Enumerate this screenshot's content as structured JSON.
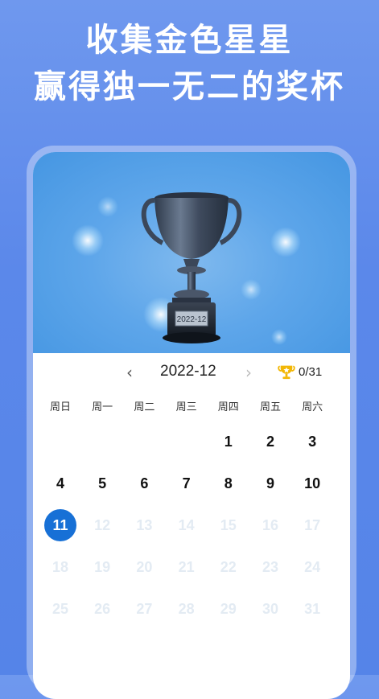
{
  "headline": {
    "line1": "收集金色星星",
    "line2": "赢得独一无二的奖杯"
  },
  "trophy": {
    "plaque_label": "2022-12",
    "color": "#3e4a5c"
  },
  "calendar": {
    "month_label": "2022-12",
    "prev_icon": "chevron-left-icon",
    "next_icon": "chevron-right-icon",
    "trophy_count": "0/31",
    "weekdays": [
      "周日",
      "周一",
      "周二",
      "周三",
      "周四",
      "周五",
      "周六"
    ],
    "first_weekday_index": 4,
    "days": [
      {
        "n": "1",
        "state": "active"
      },
      {
        "n": "2",
        "state": "active"
      },
      {
        "n": "3",
        "state": "active"
      },
      {
        "n": "4",
        "state": "active"
      },
      {
        "n": "5",
        "state": "active"
      },
      {
        "n": "6",
        "state": "active"
      },
      {
        "n": "7",
        "state": "active"
      },
      {
        "n": "8",
        "state": "active"
      },
      {
        "n": "9",
        "state": "active"
      },
      {
        "n": "10",
        "state": "active"
      },
      {
        "n": "11",
        "state": "today"
      },
      {
        "n": "12",
        "state": "future"
      },
      {
        "n": "13",
        "state": "future"
      },
      {
        "n": "14",
        "state": "future"
      },
      {
        "n": "15",
        "state": "future"
      },
      {
        "n": "16",
        "state": "future"
      },
      {
        "n": "17",
        "state": "future"
      },
      {
        "n": "18",
        "state": "future"
      },
      {
        "n": "19",
        "state": "future"
      },
      {
        "n": "20",
        "state": "future"
      },
      {
        "n": "21",
        "state": "future"
      },
      {
        "n": "22",
        "state": "future"
      },
      {
        "n": "23",
        "state": "future"
      },
      {
        "n": "24",
        "state": "future"
      },
      {
        "n": "25",
        "state": "future"
      },
      {
        "n": "26",
        "state": "future"
      },
      {
        "n": "27",
        "state": "future"
      },
      {
        "n": "28",
        "state": "future"
      },
      {
        "n": "29",
        "state": "future"
      },
      {
        "n": "30",
        "state": "future"
      },
      {
        "n": "31",
        "state": "future"
      }
    ]
  },
  "colors": {
    "background": "#5b88ea",
    "today": "#1770d6",
    "trophy_icon": "#f2b705"
  }
}
